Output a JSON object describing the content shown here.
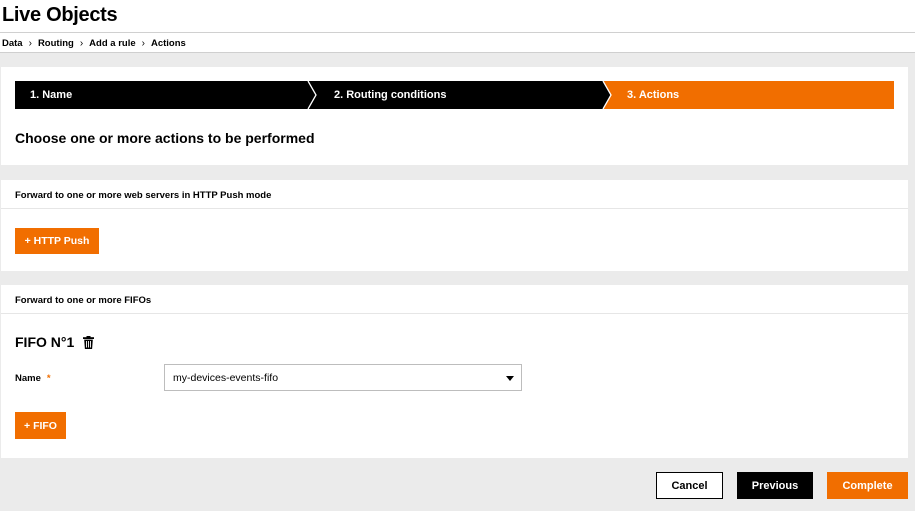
{
  "app": {
    "title": "Live Objects"
  },
  "breadcrumb": [
    "Data",
    "Routing",
    "Add a rule",
    "Actions"
  ],
  "stepper": {
    "steps": [
      {
        "label": "1. Name",
        "state": "done"
      },
      {
        "label": "2. Routing conditions",
        "state": "done"
      },
      {
        "label": "3. Actions",
        "state": "active"
      }
    ]
  },
  "intro": {
    "text": "Choose one or more actions to be performed"
  },
  "http_section": {
    "title": "Forward to one or more web servers in HTTP Push mode",
    "add_label": "+ HTTP Push"
  },
  "fifo_section": {
    "title": "Forward to one or more FIFOs",
    "fifo": {
      "title": "FIFO N°1",
      "name_label": "Name",
      "required_mark": "*",
      "name_value": "my-devices-events-fifo"
    },
    "add_label": "+ FIFO"
  },
  "footer": {
    "cancel": "Cancel",
    "previous": "Previous",
    "complete": "Complete"
  },
  "colors": {
    "accent": "#f16e00",
    "dark": "#000000",
    "background": "#ebebeb"
  },
  "icons": {
    "trash": "trash-icon",
    "dropdown": "chevron-down-icon",
    "separator": "chevron-right-icon"
  }
}
